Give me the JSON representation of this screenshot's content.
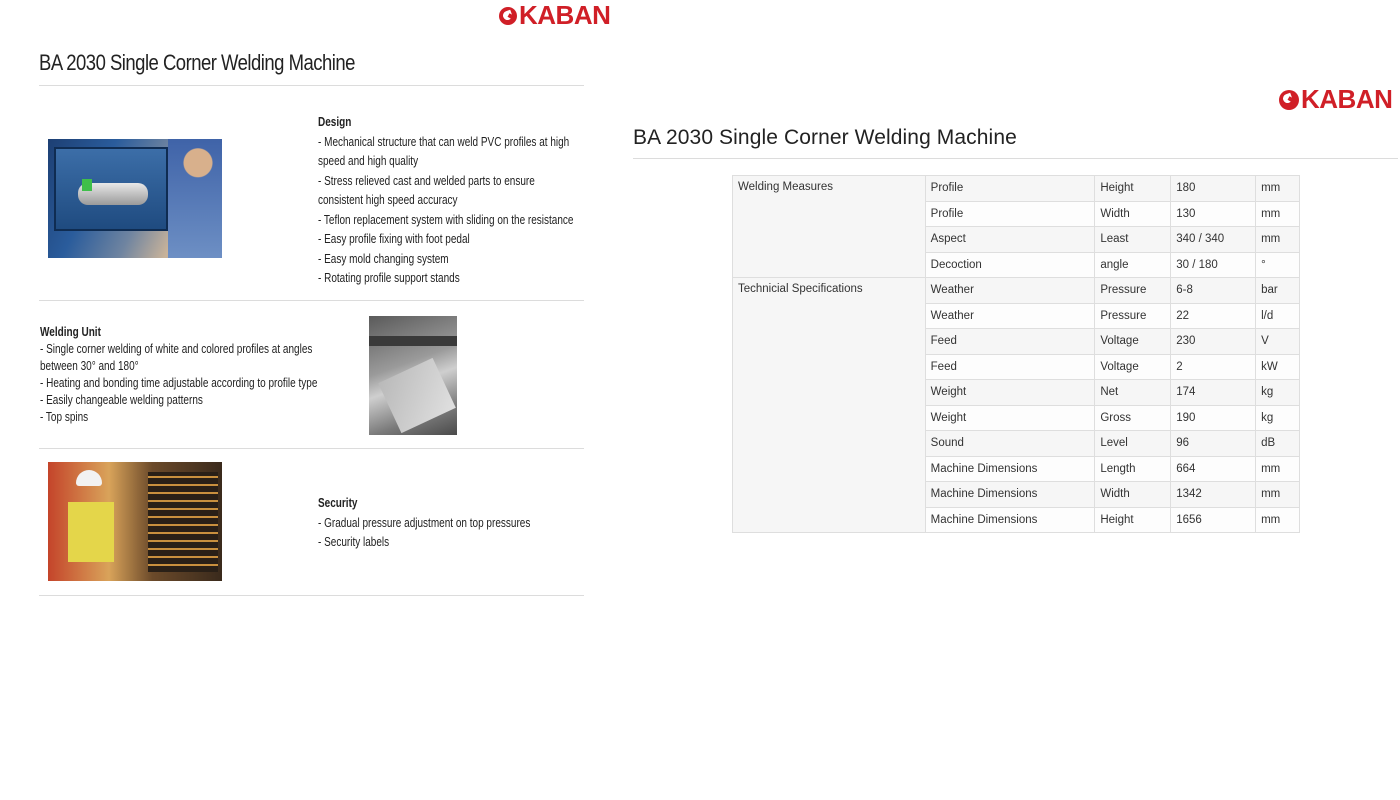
{
  "brand": "KABAN",
  "left_page": {
    "title": "BA 2030 Single Corner Welding Machine",
    "design": {
      "heading": "Design",
      "items": [
        "- Mechanical structure that can weld PVC profiles at high speed and high quality",
        "- Stress relieved cast and welded parts to ensure consistent high speed accuracy",
        "- Teflon replacement system with sliding on the resistance",
        "- Easy profile fixing with foot pedal",
        "- Easy mold changing system",
        "- Rotating profile support stands"
      ]
    },
    "welding_unit": {
      "heading": "Welding Unit",
      "items": [
        "- Single corner welding of white and colored profiles at angles between 30° and 180°",
        "- Heating and bonding time adjustable according to profile type",
        "- Easily changeable welding patterns",
        "- Top spins"
      ]
    },
    "security": {
      "heading": "Security",
      "items": [
        "- Gradual pressure adjustment on top pressures",
        "- Security labels"
      ]
    }
  },
  "right_page": {
    "title": "BA 2030 Single Corner Welding Machine",
    "groups": [
      {
        "name": "Welding Measures",
        "rows": [
          [
            "Profile",
            "Height",
            "180",
            "mm"
          ],
          [
            "Profile",
            "Width",
            "130",
            "mm"
          ],
          [
            "Aspect",
            "Least",
            "340 / 340",
            "mm"
          ],
          [
            "Decoction",
            "angle",
            "30 / 180",
            "°"
          ]
        ]
      },
      {
        "name": "Technicial Specifications",
        "rows": [
          [
            "Weather",
            "Pressure",
            "6-8",
            "bar"
          ],
          [
            "Weather",
            "Pressure",
            "22",
            "l/d"
          ],
          [
            "Feed",
            "Voltage",
            "230",
            "V"
          ],
          [
            "Feed",
            "Voltage",
            "2",
            "kW"
          ],
          [
            "Weight",
            "Net",
            "174",
            "kg"
          ],
          [
            "Weight",
            "Gross",
            "190",
            "kg"
          ],
          [
            "Sound",
            "Level",
            "96",
            "dB"
          ],
          [
            "Machine Dimensions",
            "Length",
            "664",
            "mm"
          ],
          [
            "Machine Dimensions",
            "Width",
            "1342",
            "mm"
          ],
          [
            "Machine Dimensions",
            "Height",
            "1656",
            "mm"
          ]
        ]
      }
    ]
  },
  "colors": {
    "brand_red": "#d01f27",
    "rule": "#dcdcdc"
  }
}
